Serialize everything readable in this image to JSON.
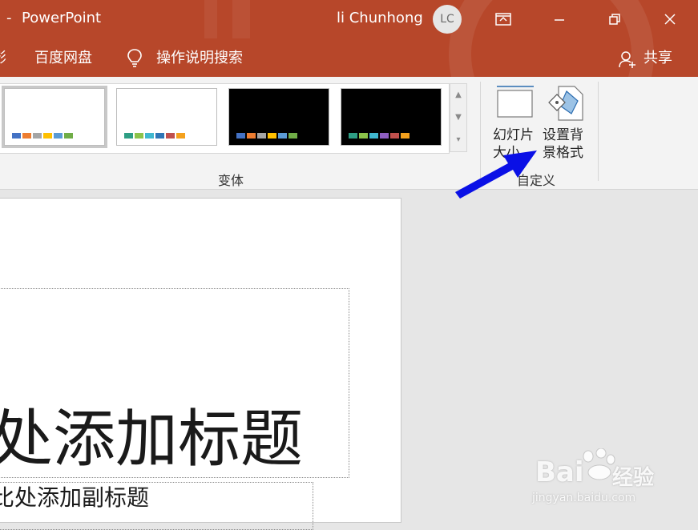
{
  "titlebar": {
    "dash": "-",
    "app_name": "PowerPoint",
    "user_name": "li Chunhong",
    "avatar_initials": "LC",
    "color": "#b7472a"
  },
  "tabs": {
    "partial_label": "影",
    "baidu_label": "百度网盘",
    "tell_me_label": "操作说明搜索",
    "share_label": "共享"
  },
  "ribbon": {
    "variants_group_label": "变体",
    "custom_group_label": "自定义",
    "slide_size_label_line1": "幻灯片",
    "slide_size_label_line2": "大小",
    "format_bg_label_line1": "设置背",
    "format_bg_label_line2": "景格式"
  },
  "variants": [
    {
      "bg": "#ffffff",
      "colors": [
        "#4472c4",
        "#ed7d31",
        "#a5a5a5",
        "#ffc000",
        "#5b9bd5",
        "#70ad47"
      ],
      "selected": true
    },
    {
      "bg": "#ffffff",
      "colors": [
        "#2e9e84",
        "#8bc34a",
        "#3fb7cf",
        "#2e75b6",
        "#c0504d",
        "#f4a11d"
      ],
      "selected": false
    },
    {
      "bg": "#000000",
      "colors": [
        "#4472c4",
        "#ed7d31",
        "#a5a5a5",
        "#ffc000",
        "#5b9bd5",
        "#70ad47"
      ],
      "selected": false
    },
    {
      "bg": "#000000",
      "colors": [
        "#2e9e84",
        "#8bc34a",
        "#3fb7cf",
        "#8e5ec1",
        "#c0504d",
        "#f4a11d"
      ],
      "selected": false
    }
  ],
  "slide": {
    "title_text": "处添加标题",
    "subtitle_text": "比处添加副标题"
  },
  "watermark": {
    "brand": "Bai",
    "brand_suffix": "经验",
    "url": "jingyan.baidu.com"
  },
  "annotation_arrow_color": "#0a10e6"
}
